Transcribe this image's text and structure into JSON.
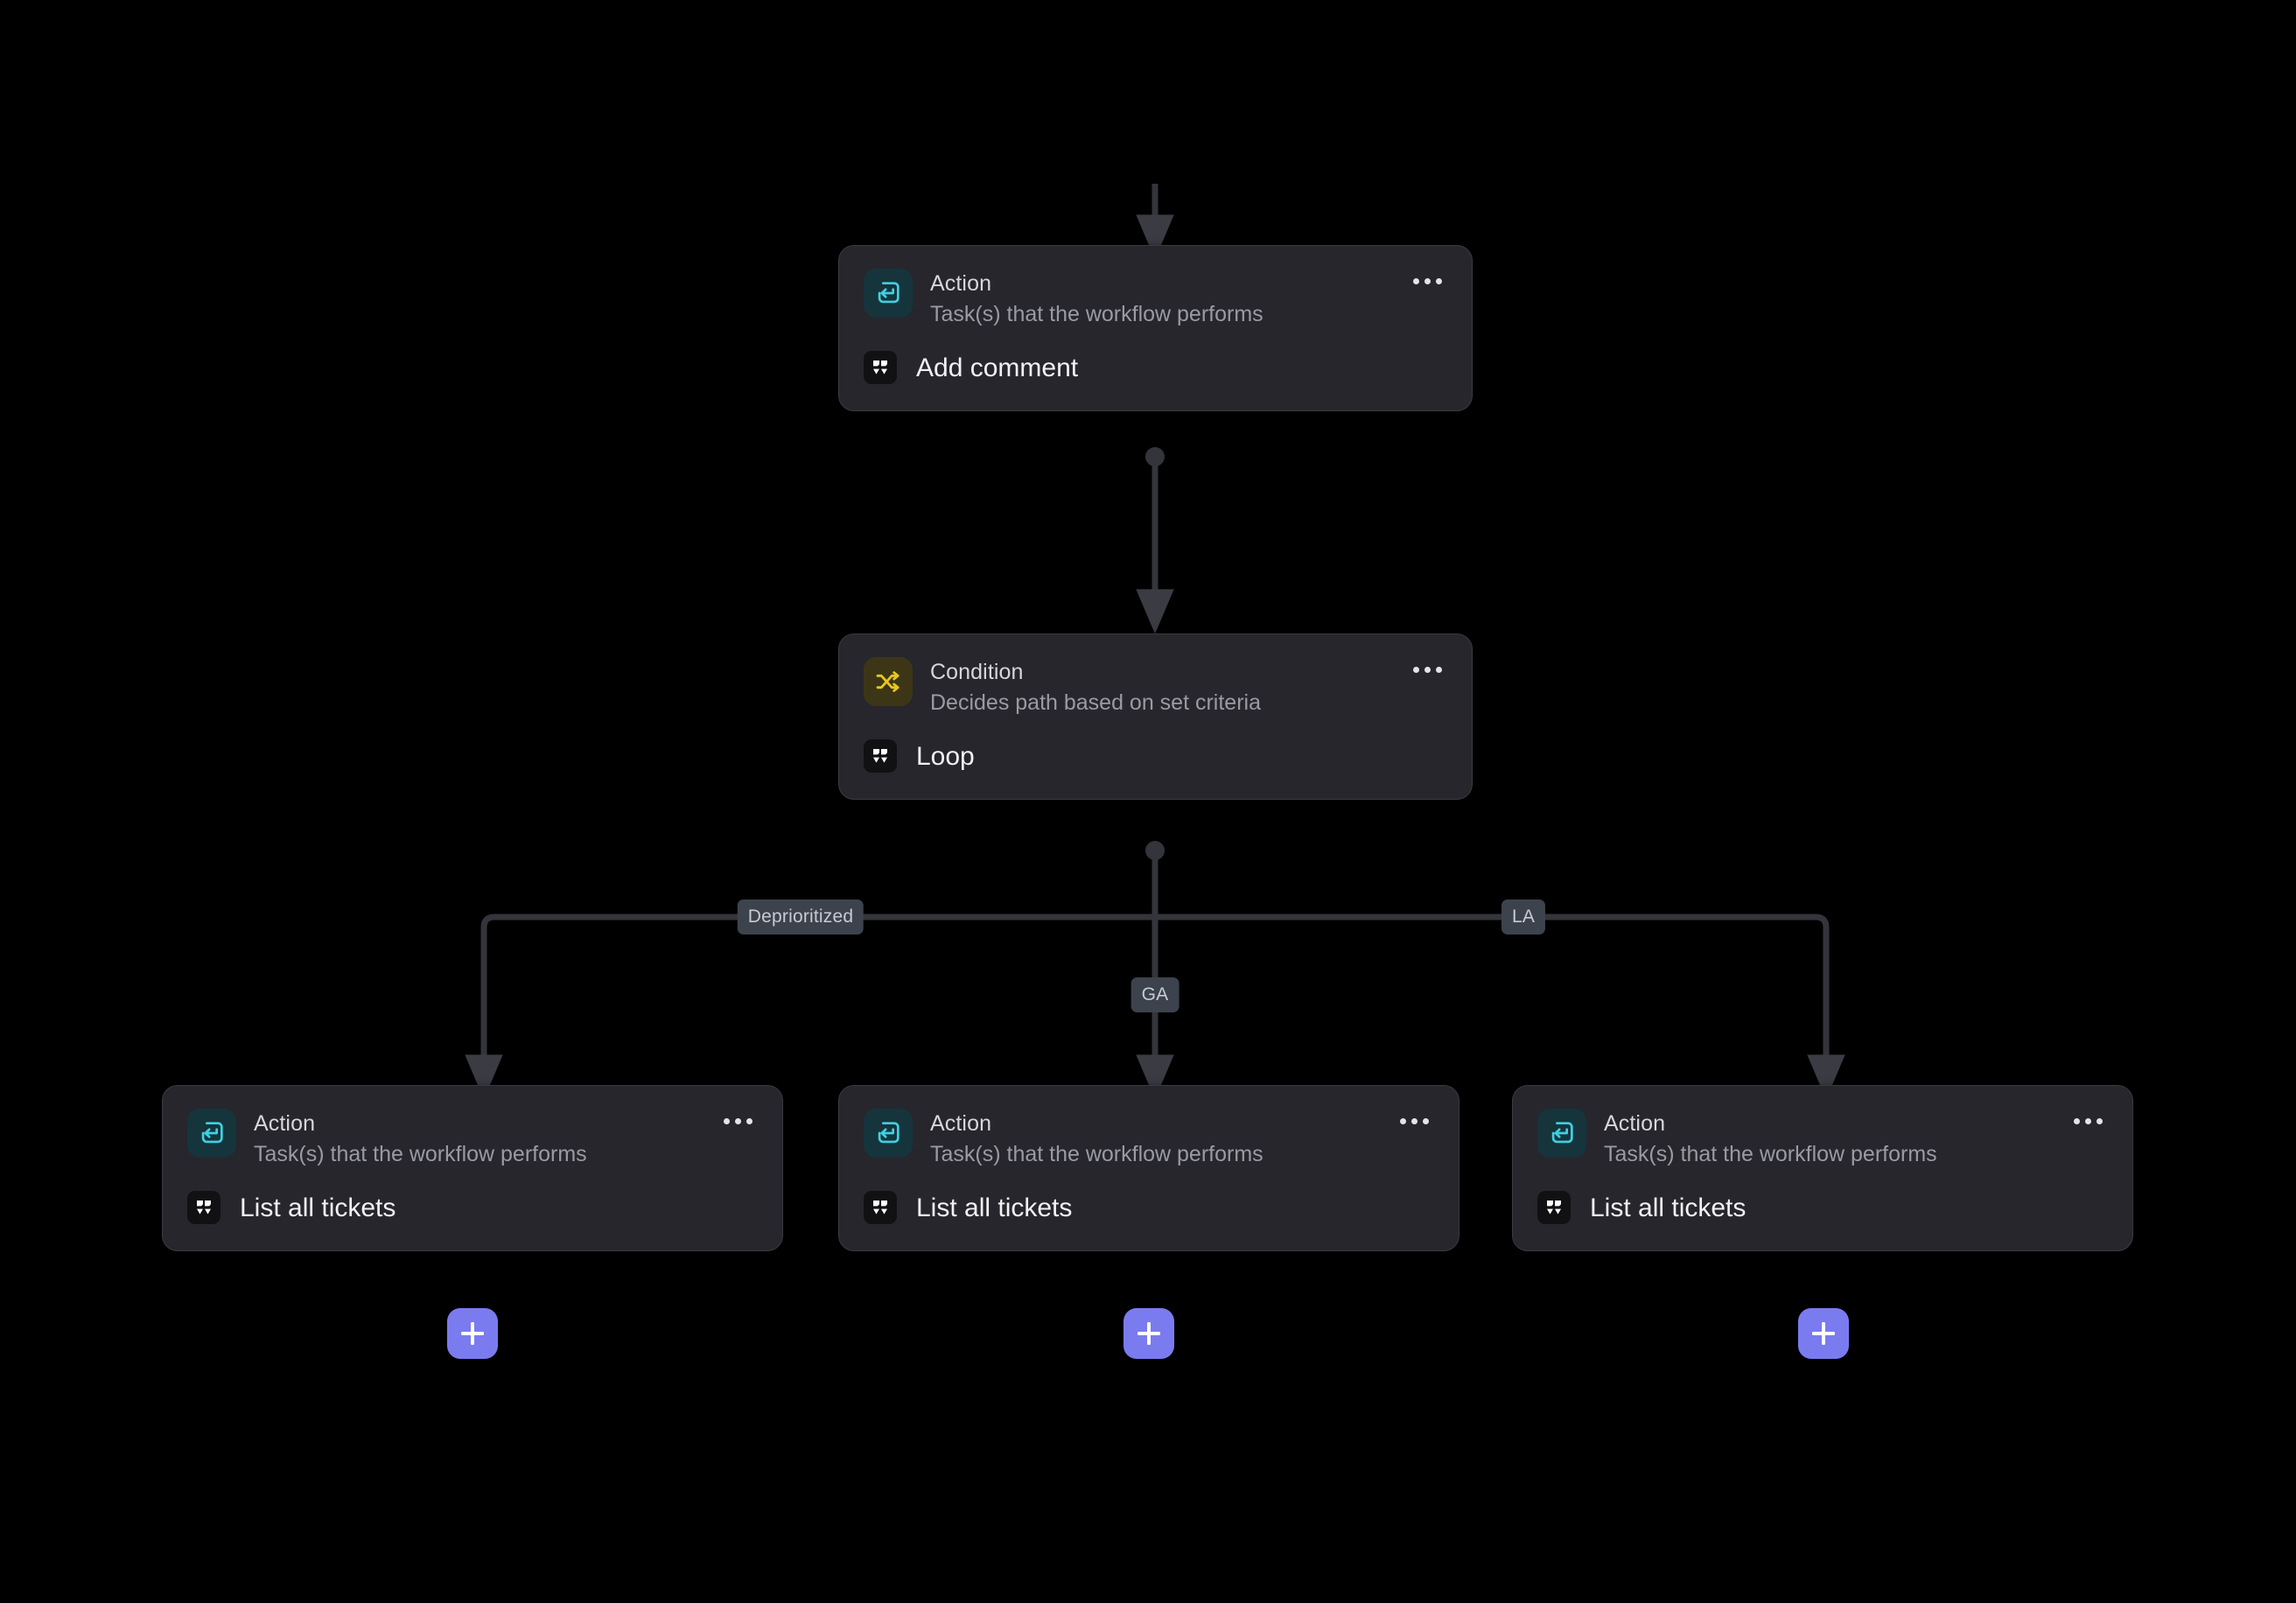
{
  "canvas": {
    "background_color": "#000000",
    "node_background_color": "#26262c",
    "accent_color": "#7b7bf0",
    "action_icon_color": "#3fd0e0",
    "condition_icon_color": "#e8c61e",
    "edge_color": "#34343c",
    "label_background_color": "#3d434c"
  },
  "nodes": [
    {
      "id": "action-top",
      "kind": "Action",
      "description": "Task(s) that the workflow performs",
      "task": "Add comment",
      "icon": "action-enter-icon",
      "app_icon": "app-logo-icon",
      "menu_icon": "more-options-icon"
    },
    {
      "id": "condition",
      "kind": "Condition",
      "description": "Decides path based on set criteria",
      "task": "Loop",
      "icon": "shuffle-icon",
      "app_icon": "app-logo-icon",
      "menu_icon": "more-options-icon"
    },
    {
      "id": "action-left",
      "kind": "Action",
      "description": "Task(s) that the workflow performs",
      "task": "List all tickets",
      "icon": "action-enter-icon",
      "app_icon": "app-logo-icon",
      "menu_icon": "more-options-icon"
    },
    {
      "id": "action-center",
      "kind": "Action",
      "description": "Task(s) that the workflow performs",
      "task": "List all tickets",
      "icon": "action-enter-icon",
      "app_icon": "app-logo-icon",
      "menu_icon": "more-options-icon"
    },
    {
      "id": "action-right",
      "kind": "Action",
      "description": "Task(s) that the workflow performs",
      "task": "List all tickets",
      "icon": "action-enter-icon",
      "app_icon": "app-logo-icon",
      "menu_icon": "more-options-icon"
    }
  ],
  "branch_labels": [
    {
      "id": "branch-left",
      "label": "Deprioritized"
    },
    {
      "id": "branch-center",
      "label": "GA"
    },
    {
      "id": "branch-right",
      "label": "LA"
    }
  ],
  "add_buttons": [
    {
      "id": "add-left",
      "label": "+"
    },
    {
      "id": "add-center",
      "label": "+"
    },
    {
      "id": "add-right",
      "label": "+"
    }
  ]
}
